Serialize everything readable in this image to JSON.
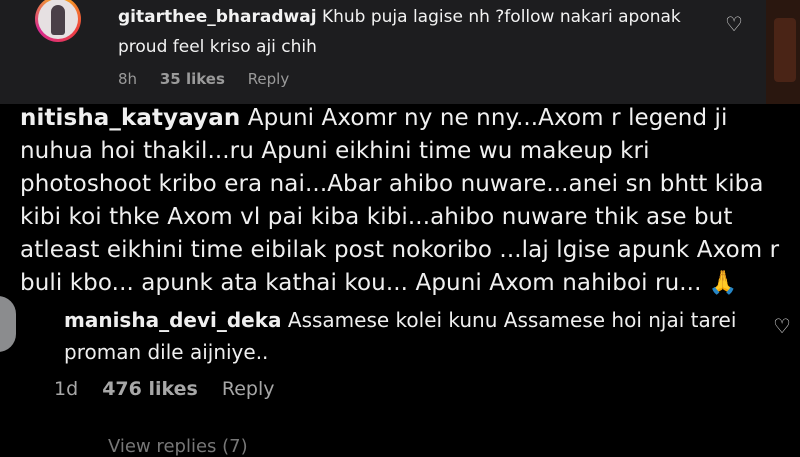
{
  "comments": [
    {
      "username": "gitarthee_bharadwaj",
      "text": "Khub puja lagise nh ?follow nakari aponak proud feel kriso aji chih",
      "time": "8h",
      "likes": "35 likes",
      "reply": "Reply",
      "heart_icon": "heart-outline-icon"
    },
    {
      "username": "nitisha_katyayan",
      "text": "Apuni Axomr ny ne nny...Axom r legend ji nuhua hoi thakil...ru Apuni eikhini time wu makeup kri photoshoot kribo era nai...Abar ahibo nuware...anei sn bhtt kiba kibi koi thke Axom vl pai kiba kibi...ahibo nuware thik ase but atleast eikhini time eibilak post nokoribo ...laj lgise apunk Axom r buli kbo... apunk ata kathai kou... Apuni Axom nahiboi ru... 🙏"
    },
    {
      "username": "manisha_devi_deka",
      "text": "Assamese kolei kunu Assamese hoi njai tarei proman dile aijniye..",
      "time": "1d",
      "likes": "476 likes",
      "reply": "Reply",
      "heart_icon": "heart-outline-icon"
    }
  ],
  "view_replies": "View replies (7)",
  "colors": {
    "background": "#000000",
    "panel": "#1d1d1f",
    "text": "#f5f5f5",
    "muted": "#9a9a9a"
  }
}
